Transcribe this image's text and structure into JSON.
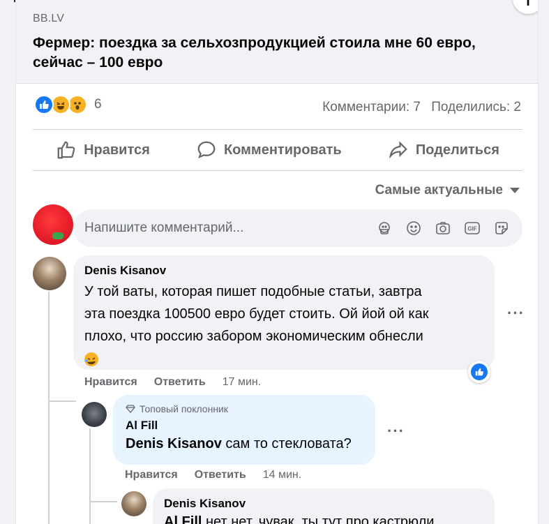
{
  "link": {
    "domain": "BB.LV",
    "headline": "Фермер: поездка за сельхозпродукцией стоила мне 60 евро, сейчас – 100 евро",
    "info_icon": "info-icon"
  },
  "reactions": {
    "count": "6",
    "comments": "Комментарии: 7",
    "shares": "Поделились: 2"
  },
  "actions": {
    "like": "Нравится",
    "comment": "Комментировать",
    "share": "Поделиться"
  },
  "sort": {
    "label": "Самые актуальные"
  },
  "composer": {
    "placeholder": "Напишите комментарий..."
  },
  "comments": [
    {
      "author": "Denis Kisanov",
      "lines": [
        "У той ваты, которая пишет подобные статьи, завтра",
        "эта поездка 100500 евро будет стоить. Ой йой ой как",
        "плохо, что россию забором экономическим обнесли"
      ],
      "like": "Нравится",
      "reply": "Ответить",
      "time": "17 мин."
    },
    {
      "badge": "Топовый поклонник",
      "author": "Al Fill",
      "mention": "Denis Kisanov",
      "text": " сам то стекловата?",
      "like": "Нравится",
      "reply": "Ответить",
      "time": "14 мин."
    },
    {
      "author": "Denis Kisanov",
      "mention": "Al Fill",
      "text": " нет нет, чувак, ты тут про кастрюли"
    }
  ],
  "colors": {
    "accent": "#1877f2",
    "muted": "#65676b",
    "bubble": "#f0f2f5",
    "bubble_highlight": "#e7f3ff"
  }
}
